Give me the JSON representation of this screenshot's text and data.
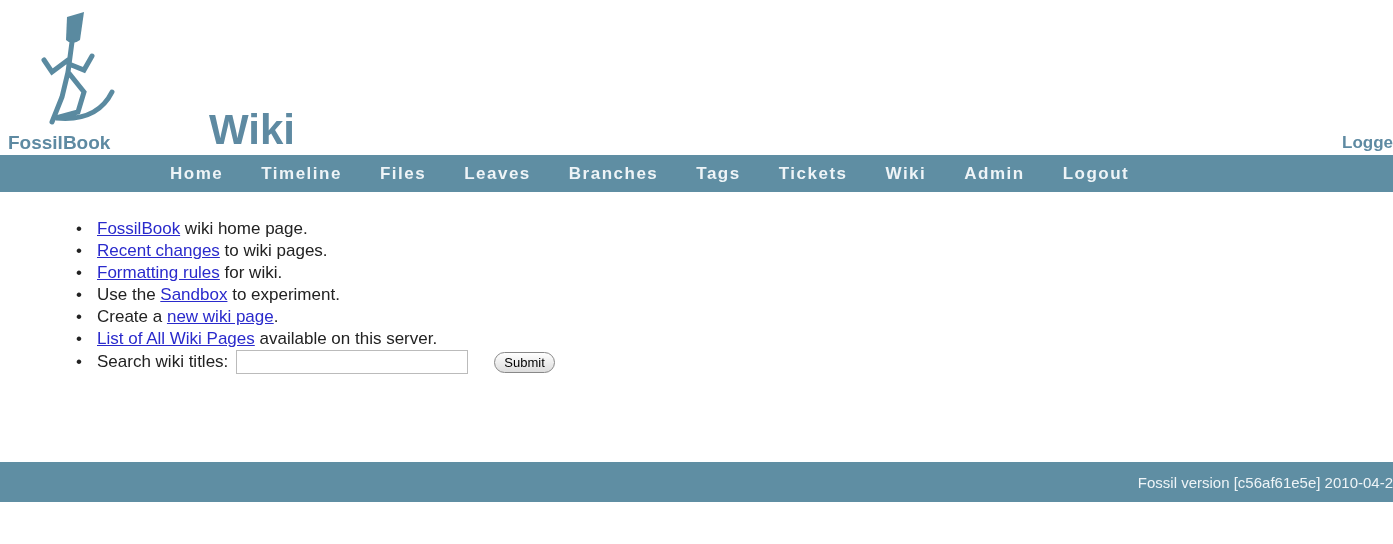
{
  "header": {
    "site_name": "FossilBook",
    "title": "Wiki",
    "login_status": "Logge"
  },
  "nav": [
    "Home",
    "Timeline",
    "Files",
    "Leaves",
    "Branches",
    "Tags",
    "Tickets",
    "Wiki",
    "Admin",
    "Logout"
  ],
  "items": [
    {
      "marker": "•",
      "link": "FossilBook",
      "after": " wiki home page."
    },
    {
      "marker": "•",
      "link": "Recent changes",
      "after": " to wiki pages."
    },
    {
      "marker": "•",
      "link": "Formatting rules",
      "after": " for wiki."
    },
    {
      "marker": "•",
      "before": "Use the ",
      "link": "Sandbox",
      "after": " to experiment."
    },
    {
      "marker": "•",
      "before": "Create a ",
      "link": "new wiki page",
      "after": "."
    },
    {
      "marker": "•",
      "link": "List of All Wiki Pages",
      "after": " available on this server."
    }
  ],
  "search": {
    "marker": "•",
    "label": "Search wiki titles:",
    "button": "Submit"
  },
  "footer": "Fossil version [c56af61e5e] 2010-04-2"
}
